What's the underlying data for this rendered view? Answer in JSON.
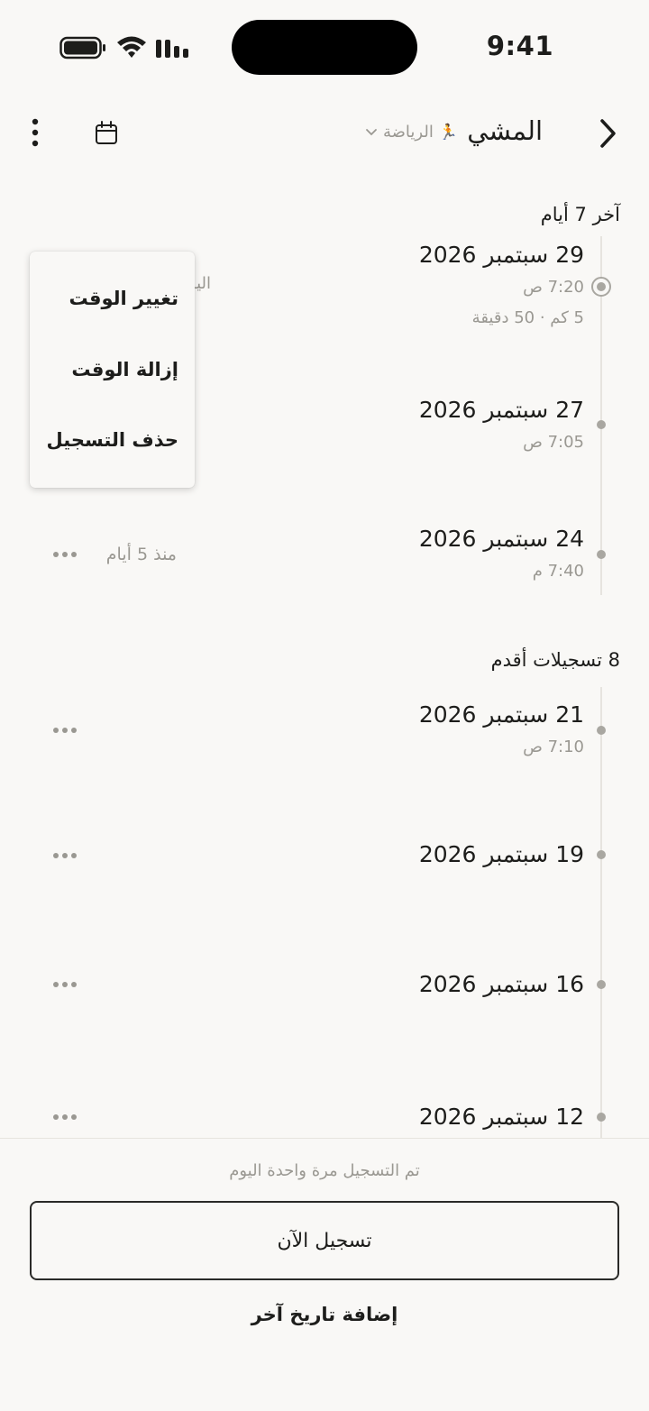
{
  "status_bar": {
    "time": "9:41"
  },
  "header": {
    "title": "المشي",
    "category": "الرياضة",
    "category_emoji": "🏃"
  },
  "sections": {
    "recent_title": "آخر 7 أيام",
    "older_title": "8 تسجيلات أقدم"
  },
  "entries": [
    {
      "date": "29 سبتمبر 2026",
      "time": "7:20 ص",
      "details": "5 كم · 50 دقيقة"
    },
    {
      "date": "27 سبتمبر 2026",
      "time": "7:05 ص"
    },
    {
      "date": "24 سبتمبر 2026",
      "time": "7:40 م",
      "relative": "منذ 5 أيام"
    },
    {
      "date": "21 سبتمبر 2026",
      "time": "7:10 ص"
    },
    {
      "date": "19 سبتمبر 2026"
    },
    {
      "date": "16 سبتمبر 2026"
    },
    {
      "date": "12 سبتمبر 2026"
    }
  ],
  "peek_text": "اليوم",
  "context_menu": {
    "change_time": "تغيير الوقت",
    "remove_time": "إزالة الوقت",
    "delete_entry": "حذف التسجيل"
  },
  "footer": {
    "logged_today": "تم التسجيل مرة واحدة اليوم",
    "log_now": "تسجيل الآن",
    "add_other_date": "إضافة تاريخ آخر"
  },
  "colors": {
    "background": "#f9f8f6",
    "text": "#1d1d1b",
    "muted": "#9a9892",
    "timeline": "#e6e4df"
  }
}
